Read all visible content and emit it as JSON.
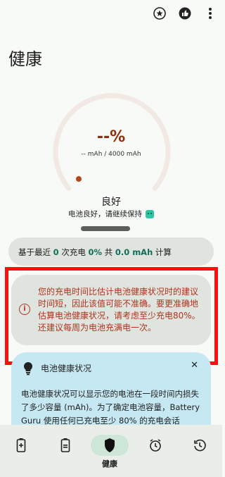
{
  "topbar": {
    "icons": [
      "badge-icon",
      "thumbs-up-icon",
      "more-vert-icon"
    ]
  },
  "page": {
    "title": "健康"
  },
  "gauge": {
    "percent_text": "--%",
    "capacity_text": "-- mAh / 4000 mAh",
    "track_color": "#f2e9e4",
    "dot_color": "#b5461b"
  },
  "health": {
    "status": "良好",
    "description": "电池良好，请继续保持"
  },
  "stats": {
    "prefix": "基于最近 ",
    "charge_count": "0",
    "mid1": " 次充电 ",
    "percent": "0%",
    "mid2": " 共 ",
    "mah": "0.0 mAh",
    "suffix": " 计算"
  },
  "warning": {
    "text": "您的充电时间比估计电池健康状况时的建议时间短，因此该值可能不准确。要更准确地估算电池健康状况，请考虑至少充电80%。还建议每周为电池充满电一次。"
  },
  "battery_card": {
    "title": "电池健康状况",
    "text": "电池健康状况可以显示您的电池在一段时间内损失了多少容量 (mAh)。为了确定电池容量，Battery Guru 使用任何已充电至少 80% 的充电会话"
  },
  "nav": {
    "active_label": "健康"
  },
  "colors": {
    "accent": "#126d5a",
    "warning": "#b1331d",
    "highlight": "#ff1010"
  }
}
